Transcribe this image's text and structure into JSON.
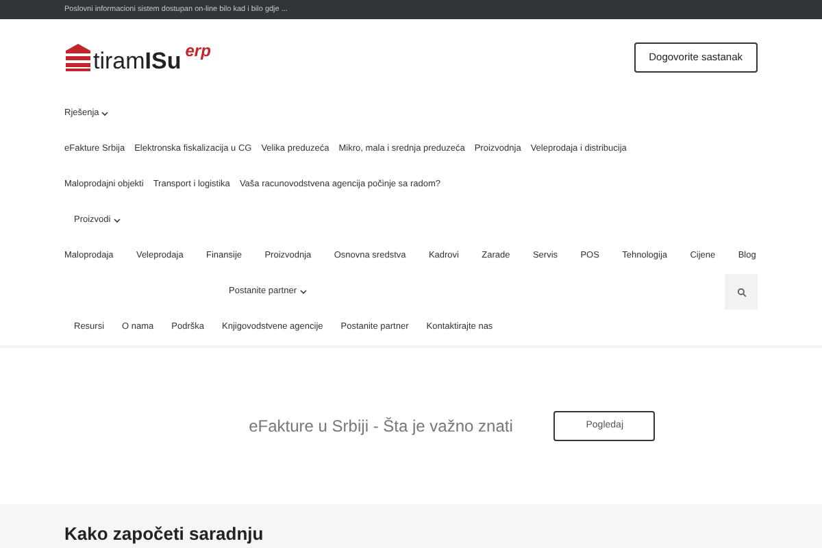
{
  "top_bar": {
    "text": "Poslovni informacioni sistem dostupan on-line bilo kad i bilo gdje ..."
  },
  "header": {
    "logo": {
      "light": "tiram",
      "bold": "ISu",
      "suffix": "erp"
    },
    "cta": "Dogovorite sastanak"
  },
  "nav_rows": [
    {
      "kind": "menu",
      "items": [
        {
          "label": "Rješenja",
          "dropdown": true
        }
      ]
    },
    {
      "kind": "links",
      "items": [
        {
          "label": "eFakture Srbija"
        },
        {
          "label": "Elektronska fiskalizacija u CG"
        },
        {
          "label": "Velika preduzeća"
        },
        {
          "label": "Mikro, mala i srednja preduzeća"
        },
        {
          "label": "Proizvodnja"
        },
        {
          "label": "Veleprodaja i distribucija"
        }
      ]
    },
    {
      "kind": "links",
      "items": [
        {
          "label": "Maloprodajni objekti"
        },
        {
          "label": "Transport i logistika"
        },
        {
          "label": "Vaša racunovodstvena agencija počinje sa radom?"
        }
      ]
    },
    {
      "kind": "submenu",
      "items": [
        {
          "label": "Proizvodi",
          "dropdown": true
        }
      ]
    },
    {
      "kind": "spread",
      "items": [
        {
          "label": "Maloprodaja"
        },
        {
          "label": "Veleprodaja"
        },
        {
          "label": "Finansije"
        },
        {
          "label": "Proizvodnja"
        },
        {
          "label": "Osnovna sredstva"
        },
        {
          "label": "Kadrovi"
        },
        {
          "label": "Zarade"
        },
        {
          "label": "Servis"
        },
        {
          "label": "POS"
        },
        {
          "label": "Tehnologija"
        },
        {
          "label": "Cijene"
        },
        {
          "label": "Blog"
        }
      ]
    },
    {
      "kind": "partner",
      "items": [
        {
          "label": "Postanite partner",
          "dropdown": true
        }
      ],
      "search": true
    },
    {
      "kind": "sublinks",
      "items": [
        {
          "label": "Resursi"
        },
        {
          "label": "O nama"
        },
        {
          "label": "Podrška"
        },
        {
          "label": "Knjigovodstvene agencije"
        },
        {
          "label": "Postanite partner"
        },
        {
          "label": "Kontaktirajte nas"
        }
      ]
    }
  ],
  "banner": {
    "text": "eFakture u Srbiji - Šta je važno znati",
    "button": "Pogledaj"
  },
  "section": {
    "heading": "Kako započeti saradnju"
  }
}
